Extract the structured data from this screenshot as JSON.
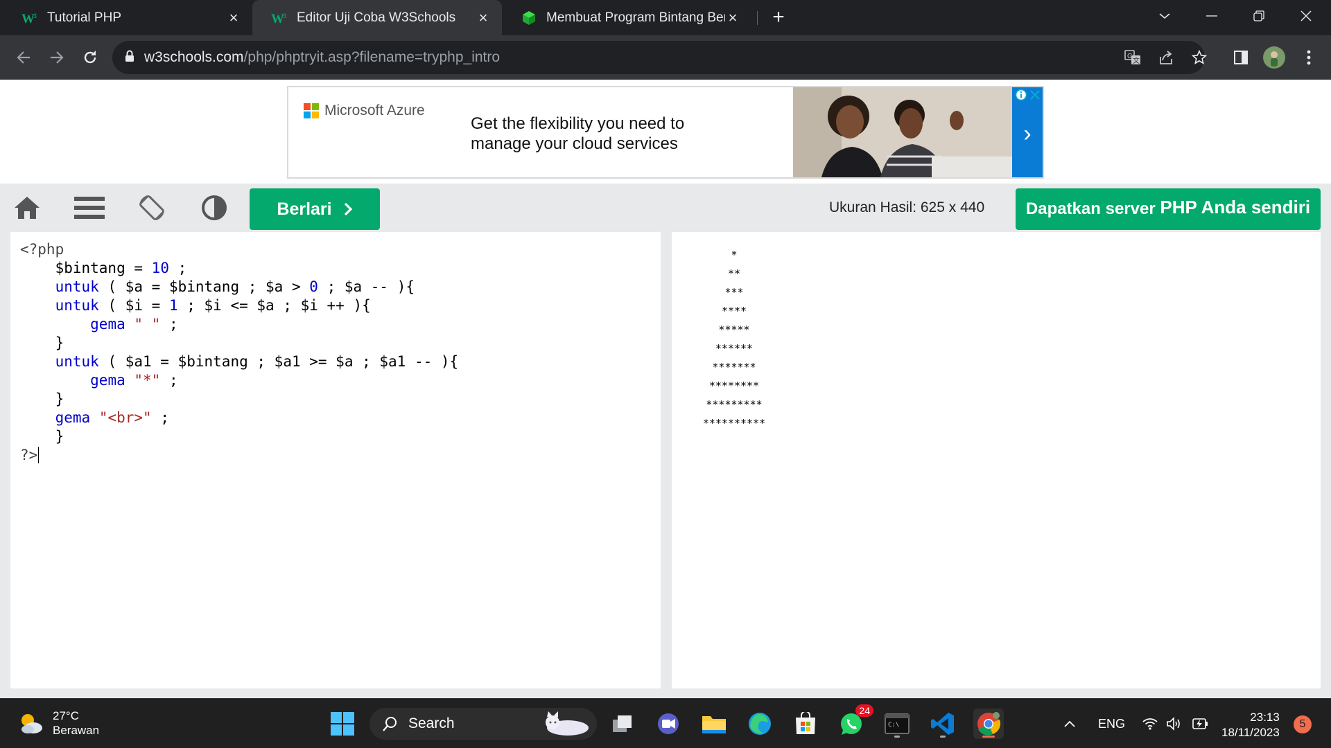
{
  "browser": {
    "tabs": [
      {
        "title": "Tutorial PHP"
      },
      {
        "title": "Editor Uji Coba W3Schools",
        "active": true
      },
      {
        "title": "Membuat Program Bintang Bent"
      }
    ],
    "new_tab": "+",
    "url_host": "w3schools.com",
    "url_path": "/php/phptryit.asp?filename=tryphp_intro"
  },
  "ad": {
    "brand": "Microsoft Azure",
    "headline_line1": "Get the flexibility you need to",
    "headline_line2": "manage your cloud services",
    "arrow": "›"
  },
  "editor_toolbar": {
    "run_label": "Berlari",
    "result_size": "Ukuran Hasil: 625 x 440",
    "server_label_prefix": "Dapatkan server ",
    "server_label_suffix": "PHP Anda sendiri"
  },
  "code": {
    "l1": "<?php",
    "v_bintang": "$bintang",
    "n10": "10",
    "kw_untuk": "untuk",
    "kw_gema": "gema",
    "s_space": "\" \"",
    "s_star": "\"*\"",
    "s_br": "\"<br>\"",
    "end": "?>"
  },
  "output": {
    "rows": [
      "*",
      "**",
      "***",
      "****",
      "*****",
      "******",
      "*******",
      "********",
      "*********",
      "**********"
    ]
  },
  "taskbar": {
    "temp": "27°C",
    "weather": "Berawan",
    "search_label": "Search",
    "whatsapp_badge": "24",
    "lang": "ENG",
    "time": "23:13",
    "date": "18/11/2023",
    "notifications": "5"
  },
  "colors": {
    "w3_green": "#04aa6d",
    "azure_blue": "#0a7cd6",
    "keyword_blue": "#0000cd",
    "string_brown": "#a52a2a"
  }
}
